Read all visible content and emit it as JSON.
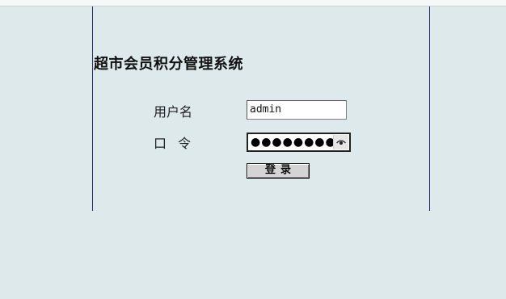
{
  "app": {
    "title": "超市会员积分管理系统"
  },
  "form": {
    "username_label": "用户名",
    "username_value": "admin",
    "password_label": "口令",
    "password_mask": "●●●●●●●●",
    "reveal_icon": "eye-icon",
    "login_label": "登录"
  },
  "colors": {
    "background": "#dde9ea",
    "panel_border": "#2a2a6a",
    "button_face": "#d4d4d4"
  }
}
